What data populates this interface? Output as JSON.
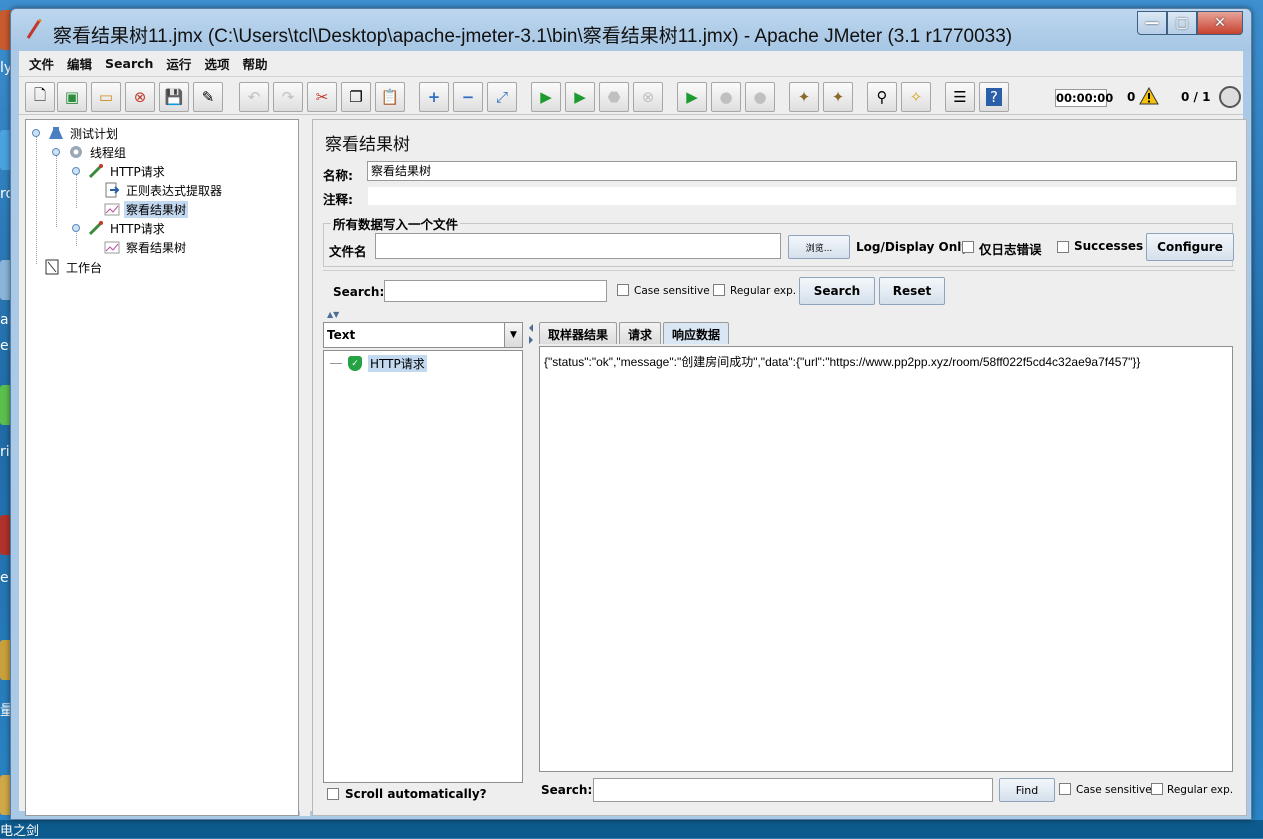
{
  "window": {
    "title": "察看结果树11.jmx (C:\\Users\\tcl\\Desktop\\apache-jmeter-3.1\\bin\\察看结果树11.jmx) - Apache JMeter (3.1 r1770033)"
  },
  "desktop": {
    "side_text": [
      "ly",
      "ro",
      "al",
      "er",
      "ri",
      "e",
      "量"
    ],
    "bottom_text": "电之剑"
  },
  "menu": [
    "文件",
    "编辑",
    "Search",
    "运行",
    "选项",
    "帮助"
  ],
  "toolbar": {
    "elapsed": "00:00:00",
    "error_count": "0",
    "threads": "0 / 1"
  },
  "tree": {
    "nodes": [
      {
        "label": "测试计划"
      },
      {
        "label": "线程组"
      },
      {
        "label": "HTTP请求"
      },
      {
        "label": "正则表达式提取器"
      },
      {
        "label": "察看结果树"
      },
      {
        "label": "HTTP请求"
      },
      {
        "label": "察看结果树"
      },
      {
        "label": "工作台"
      }
    ]
  },
  "panel": {
    "title": "察看结果树",
    "name_label": "名称:",
    "name_value": "察看结果树",
    "comment_label": "注释:",
    "comment_value": "",
    "file_group_title": "所有数据写入一个文件",
    "filename_label": "文件名",
    "filename_value": "",
    "browse_button": "浏览...",
    "log_display_label": "Log/Display Only:",
    "errors_only_label": "仅日志错误",
    "successes_label": "Successes",
    "configure_button": "Configure"
  },
  "search": {
    "label": "Search:",
    "value": "",
    "case_sensitive": "Case sensitive",
    "regular_exp": "Regular exp.",
    "search_button": "Search",
    "reset_button": "Reset"
  },
  "results": {
    "renderer": "Text",
    "sample": "HTTP请求",
    "scroll_auto": "Scroll automatically?",
    "tabs": [
      "取样器结果",
      "请求",
      "响应数据"
    ],
    "active_tab": "响应数据",
    "response": "{\"status\":\"ok\",\"message\":\"创建房间成功\",\"data\":{\"url\":\"https://www.pp2pp.xyz/room/58ff022f5cd4c32ae9a7f457\"}}",
    "find_label": "Search:",
    "find_value": "",
    "find_button": "Find",
    "find_case_sensitive": "Case sensitive",
    "find_regular_exp": "Regular exp."
  },
  "colors": {
    "selection": "#c3d9f0",
    "success_icon": "#25a244",
    "window_frame": "#a9c9e6"
  }
}
